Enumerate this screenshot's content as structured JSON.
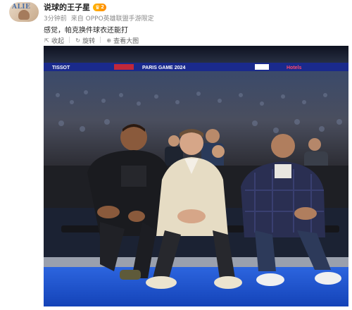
{
  "author": {
    "avatar_text": "ALIE",
    "name": "说球的王子星",
    "badge": "2"
  },
  "meta": {
    "time": "3分钟前",
    "source_prefix": "来自",
    "source": "OPPO英雄联盟手游限定"
  },
  "post": {
    "text": "感觉，帕克换件球衣还能打"
  },
  "actions": {
    "collapse": "收起",
    "rotate": "旋转",
    "view_large": "查看大图"
  },
  "photo": {
    "banner_left": "TISSOT",
    "banner_mid": "PARIS GAME 2024",
    "banner_right": "Hotels"
  },
  "colors": {
    "accent": "#ff8a00",
    "court": "#1a56d6",
    "banner": "#1a2a8c"
  }
}
